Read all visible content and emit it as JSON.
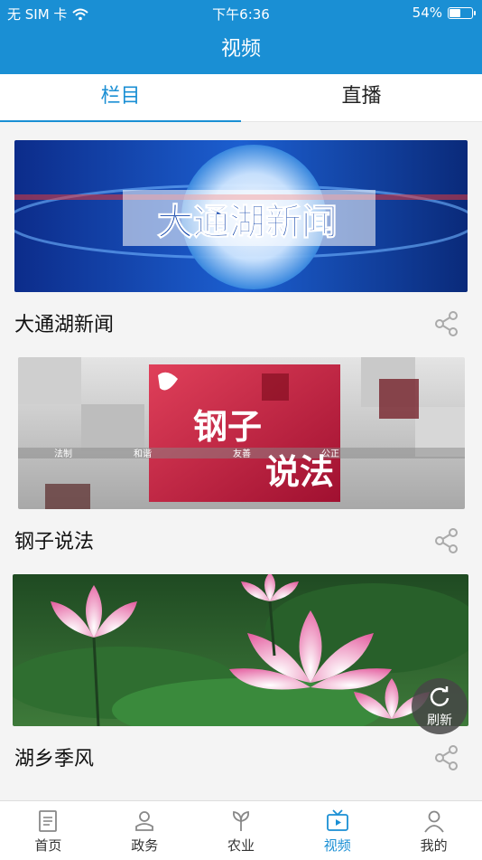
{
  "status": {
    "carrier": "无 SIM 卡",
    "time": "下午6:36",
    "battery": "54%",
    "battery_level": 0.54
  },
  "nav": {
    "title": "视频"
  },
  "tabs": [
    {
      "label": "栏目"
    },
    {
      "label": "直播"
    }
  ],
  "cards": [
    {
      "title": "大通湖新闻",
      "banner_text": "大通湖新闻"
    },
    {
      "title": "钢子说法",
      "banner_text_1": "钢子",
      "banner_text_2": "说法",
      "banner_tags": [
        "法制",
        "和谐",
        "友善",
        "公正"
      ]
    },
    {
      "title": "湖乡季风"
    }
  ],
  "refresh": {
    "label": "刷新"
  },
  "tabbar": [
    {
      "label": "首页",
      "icon": "home-icon"
    },
    {
      "label": "政务",
      "icon": "government-icon"
    },
    {
      "label": "农业",
      "icon": "agriculture-icon"
    },
    {
      "label": "视频",
      "icon": "tv-icon"
    },
    {
      "label": "我的",
      "icon": "profile-icon"
    }
  ],
  "colors": {
    "accent": "#1a8fd4"
  }
}
